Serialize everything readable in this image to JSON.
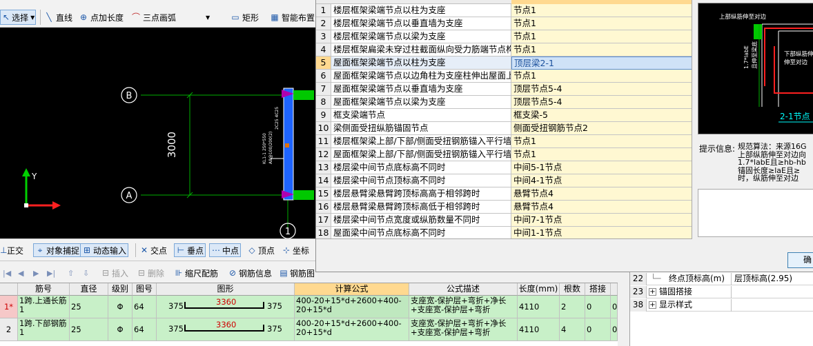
{
  "toolbar": {
    "select_label": "选择",
    "line_label": "直线",
    "point_length_label": "点加长度",
    "arc_label": "三点画弧",
    "rect_label": "矩形",
    "smart_layout_label": "智能布置"
  },
  "canvas": {
    "axis_b": "B",
    "axis_a": "A",
    "axis_1": "1",
    "dimension": "3000",
    "y_label": "Y",
    "beam_text_1": "KL1-1 250*550",
    "beam_text_2": "A8@100/200(2)",
    "beam_text_3": "2C25 4C25"
  },
  "snapbar": {
    "ortho": "正交",
    "object_snap": "对象捕捉",
    "dynamic_input": "动态输入",
    "intersection": "交点",
    "perpendicular": "垂点",
    "midpoint": "中点",
    "vertex": "顶点",
    "coordinate": "坐标"
  },
  "rebarbar": {
    "insert": "插入",
    "delete": "删除",
    "scale_rebar": "缩尺配筋",
    "rebar_info": "钢筋信息",
    "rebar_graph": "钢筋图"
  },
  "rebar_table": {
    "headers": [
      "筋号",
      "直径(mm)",
      "级别",
      "图号",
      "图形",
      "计算公式",
      "公式描述",
      "长度(mm)",
      "根数",
      "搭接"
    ],
    "rows": [
      {
        "index": "1*",
        "name": "1跨.上通长筋1",
        "diameter": "25",
        "grade": "Φ",
        "figure_no": "64",
        "shape_left": "375",
        "shape_mid": "3360",
        "shape_right": "375",
        "formula": "400-20+15*d+2600+400-20+15*d",
        "description": "支座宽-保护层+弯折+净长+支座宽-保护层+弯折",
        "length": "4110",
        "count": "2",
        "lap": "0",
        "extra": "0"
      },
      {
        "index": "2",
        "name": "1跨.下部钢筋1",
        "diameter": "25",
        "grade": "Φ",
        "figure_no": "64",
        "shape_left": "375",
        "shape_mid": "3360",
        "shape_right": "375",
        "formula": "400-20+15*d+2600+400-20+15*d",
        "description": "支座宽-保护层+弯折+净长+支座宽-保护层+弯折",
        "length": "4110",
        "count": "4",
        "lap": "0",
        "extra": "0"
      }
    ]
  },
  "props": {
    "rows": [
      {
        "no": "22",
        "label": "终点顶标高(m)",
        "value": "层顶标高(2.95)",
        "expander": false
      },
      {
        "no": "23",
        "label": "锚固搭接",
        "value": "",
        "expander": true
      },
      {
        "no": "38",
        "label": "显示样式",
        "value": "",
        "expander": true
      }
    ]
  },
  "dialog": {
    "rows": [
      {
        "no": "1",
        "name": "楼层框架梁端节点以柱为支座",
        "value": "节点1"
      },
      {
        "no": "2",
        "name": "楼层框架梁端节点以垂直墙为支座",
        "value": "节点1"
      },
      {
        "no": "3",
        "name": "楼层框架梁端节点以梁为支座",
        "value": "节点1"
      },
      {
        "no": "4",
        "name": "楼层框架扁梁未穿过柱截面纵向受力筋端节点构",
        "value": "节点1"
      },
      {
        "no": "5",
        "name": "屋面框架梁端节点以柱为支座",
        "value": "顶层梁2-1"
      },
      {
        "no": "6",
        "name": "屋面框架梁端节点以边角柱为支座柱伸出屋面上",
        "value": "节点1"
      },
      {
        "no": "7",
        "name": "屋面框架梁端节点以垂直墙为支座",
        "value": "顶层节点5-4"
      },
      {
        "no": "8",
        "name": "屋面框架梁端节点以梁为支座",
        "value": "顶层节点5-4"
      },
      {
        "no": "9",
        "name": "框支梁端节点",
        "value": "框支梁-5"
      },
      {
        "no": "10",
        "name": "梁侧面受扭纵筋锚固节点",
        "value": "侧面受扭钢筋节点2"
      },
      {
        "no": "11",
        "name": "楼层框架梁上部/下部/侧面受扭钢筋锚入平行墙",
        "value": "节点1"
      },
      {
        "no": "12",
        "name": "屋面框架梁上部/下部/侧面受扭钢筋锚入平行墙",
        "value": "节点1"
      },
      {
        "no": "13",
        "name": "楼层梁中间节点底标高不同时",
        "value": "中间5-1节点"
      },
      {
        "no": "14",
        "name": "楼层梁中间节点顶标高不同时",
        "value": "中间4-1节点"
      },
      {
        "no": "15",
        "name": "楼层悬臂梁悬臂跨顶标高高于相邻跨时",
        "value": "悬臂节点4"
      },
      {
        "no": "16",
        "name": "楼层悬臂梁悬臂跨顶标高低于相邻跨时",
        "value": "悬臂节点4"
      },
      {
        "no": "17",
        "name": "楼层梁中间节点宽度或纵筋数量不同时",
        "value": "中间7-1节点"
      },
      {
        "no": "18",
        "name": "屋面梁中间节点底标高不同时",
        "value": "中间1-1节点"
      }
    ],
    "preview": {
      "top_text": "上部纵筋伸至对边",
      "left_text": "1.7*labE",
      "left_text_2": "且伸至梁底",
      "right_text_1": "下部纵筋伸",
      "right_text_2": "伸至对边",
      "caption": "2-1节点"
    },
    "tip_label": "提示信息:",
    "tip_text": "规范算法：来源16G\n上部纵筋伸至对边向\n1.7*labE且≥hb-hb\n锚固长度≥laE且≥\n时，纵筋伸至对边",
    "ok_label": "确定"
  },
  "colors": {
    "canvas_bg": "#000000",
    "dim_line": "#00b000",
    "column": "#1e64ff",
    "beam": "#00c800",
    "selected_value": "#1a4f9c"
  }
}
